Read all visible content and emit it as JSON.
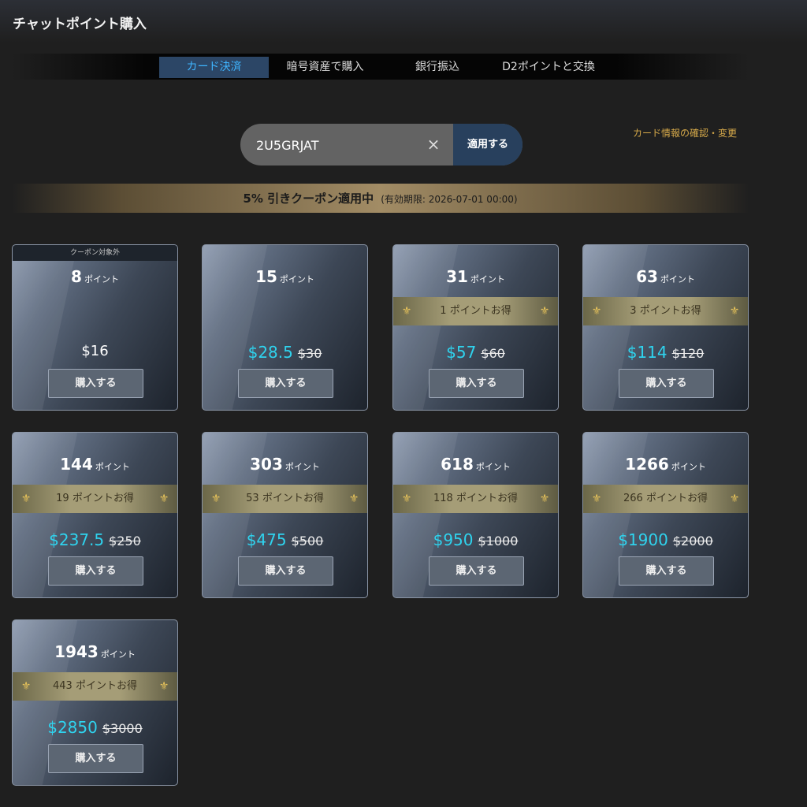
{
  "header": {
    "title": "チャットポイント購入"
  },
  "tabs": [
    {
      "label": "カード決済",
      "active": true
    },
    {
      "label": "暗号資産で購入",
      "active": false
    },
    {
      "label": "銀行振込",
      "active": false
    },
    {
      "label": "D2ポイントと交換",
      "active": false
    }
  ],
  "coupon": {
    "value": "2U5GRJAT",
    "clear_icon": "×",
    "apply_label": "適用する",
    "card_info_link": "カード情報の確認・変更",
    "banner_main": "5% 引きクーポン適用中",
    "banner_expiry": "(有効期限: 2026-07-01 00:00)"
  },
  "colors": {
    "accent": "#2fd3ee",
    "active_tab": "#3fb5ff",
    "gold": "#d7aa4a"
  },
  "cards": [
    {
      "note": "クーポン対象外",
      "points": "8",
      "unit": "ポイント",
      "bonus": "",
      "price": "$16",
      "old_price": "",
      "buy_label": "購入する"
    },
    {
      "note": "",
      "points": "15",
      "unit": "ポイント",
      "bonus": "",
      "price": "$28.5",
      "old_price": "$30",
      "buy_label": "購入する"
    },
    {
      "note": "",
      "points": "31",
      "unit": "ポイント",
      "bonus": "1 ポイントお得",
      "price": "$57",
      "old_price": "$60",
      "buy_label": "購入する"
    },
    {
      "note": "",
      "points": "63",
      "unit": "ポイント",
      "bonus": "3 ポイントお得",
      "price": "$114",
      "old_price": "$120",
      "buy_label": "購入する"
    },
    {
      "note": "",
      "points": "144",
      "unit": "ポイント",
      "bonus": "19 ポイントお得",
      "price": "$237.5",
      "old_price": "$250",
      "buy_label": "購入する"
    },
    {
      "note": "",
      "points": "303",
      "unit": "ポイント",
      "bonus": "53 ポイントお得",
      "price": "$475",
      "old_price": "$500",
      "buy_label": "購入する"
    },
    {
      "note": "",
      "points": "618",
      "unit": "ポイント",
      "bonus": "118 ポイントお得",
      "price": "$950",
      "old_price": "$1000",
      "buy_label": "購入する"
    },
    {
      "note": "",
      "points": "1266",
      "unit": "ポイント",
      "bonus": "266 ポイントお得",
      "price": "$1900",
      "old_price": "$2000",
      "buy_label": "購入する"
    },
    {
      "note": "",
      "points": "1943",
      "unit": "ポイント",
      "bonus": "443 ポイントお得",
      "price": "$2850",
      "old_price": "$3000",
      "buy_label": "購入する"
    }
  ]
}
